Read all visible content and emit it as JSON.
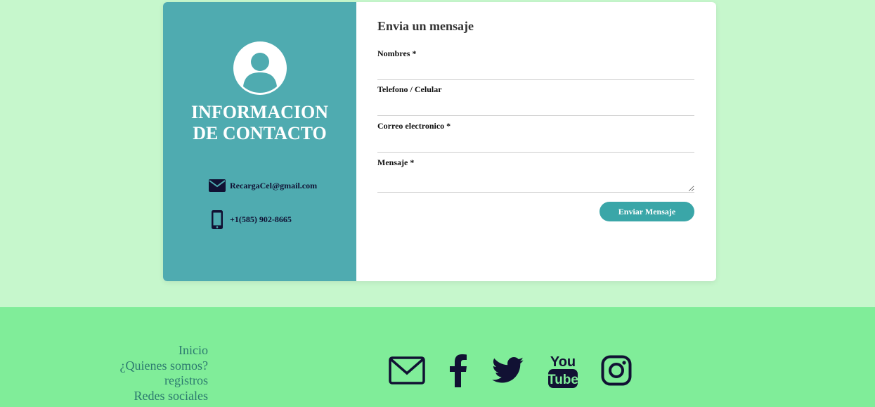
{
  "info": {
    "title_line1": "INFORMACION",
    "title_line2": "DE CONTACTO",
    "email": "RecargaCel@gmail.com",
    "phone": "+1(585) 902-8665",
    "avatar_icon": "user-avatar-icon",
    "email_icon": "envelope-icon",
    "phone_icon": "smartphone-icon",
    "panel_color": "#4fabb0"
  },
  "form": {
    "title": "Envia un mensaje",
    "fields": [
      {
        "label": "Nombres *",
        "value": ""
      },
      {
        "label": "Telefono / Celular",
        "value": ""
      },
      {
        "label": "Correo electronico *",
        "value": ""
      },
      {
        "label": "Mensaje *",
        "value": ""
      }
    ],
    "submit_label": "Enviar Mensaje",
    "button_color": "#3aa6a8"
  },
  "footer": {
    "links": [
      "Inicio",
      "¿Quienes somos?",
      "registros",
      "Redes sociales"
    ],
    "social_icons": [
      "mail-icon",
      "facebook-icon",
      "twitter-icon",
      "youtube-icon",
      "instagram-icon"
    ],
    "background": "#80ed99",
    "page_background": "#c6f7cc"
  }
}
